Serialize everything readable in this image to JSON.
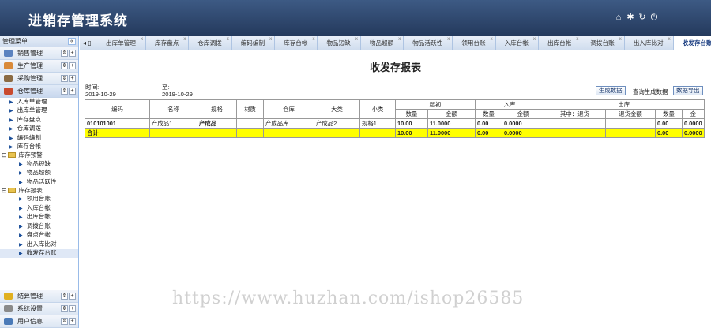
{
  "app": {
    "title": "进销存管理系统"
  },
  "top_icons": [
    {
      "name": "home-icon",
      "glyph": "⌂"
    },
    {
      "name": "gear-icon",
      "glyph": "✱"
    },
    {
      "name": "refresh-icon",
      "glyph": "↻"
    },
    {
      "name": "power-icon",
      "glyph": "⏻"
    }
  ],
  "sidebar": {
    "header": "管理菜单",
    "collapse": "«",
    "groups_top": [
      {
        "label": "销售管理",
        "color": "#5b83c0"
      },
      {
        "label": "生产管理",
        "color": "#d98a3a"
      },
      {
        "label": "采购管理",
        "color": "#8b6b44"
      },
      {
        "label": "仓库管理",
        "color": "#c94a2e"
      }
    ],
    "tree": [
      {
        "label": "入库单管理",
        "type": "node"
      },
      {
        "label": "出库单管理",
        "type": "node"
      },
      {
        "label": "库存盘点",
        "type": "node"
      },
      {
        "label": "仓库调拨",
        "type": "node"
      },
      {
        "label": "编码编制",
        "type": "node"
      },
      {
        "label": "库存台帐",
        "type": "node"
      },
      {
        "label": "库存预警",
        "type": "folder"
      },
      {
        "label": "物品短缺",
        "type": "sub"
      },
      {
        "label": "物品超额",
        "type": "sub"
      },
      {
        "label": "物品活跃性",
        "type": "sub"
      },
      {
        "label": "库存报表",
        "type": "folder"
      },
      {
        "label": "领用台账",
        "type": "sub"
      },
      {
        "label": "入库台帐",
        "type": "sub"
      },
      {
        "label": "出库台帐",
        "type": "sub"
      },
      {
        "label": "调拨台账",
        "type": "sub"
      },
      {
        "label": "盘点台帐",
        "type": "sub"
      },
      {
        "label": "出入库比对",
        "type": "sub"
      },
      {
        "label": "收发存台账",
        "type": "sub"
      }
    ],
    "groups_bottom": [
      {
        "label": "结算管理",
        "color": "#e0b020"
      },
      {
        "label": "系统设置",
        "color": "#8a8a8a"
      },
      {
        "label": "用户信息",
        "color": "#4a7ab8"
      }
    ]
  },
  "tabs": {
    "nav_left": "◂ ▯",
    "items": [
      "出库单管理",
      "库存盘点",
      "仓库调拨",
      "编码编制",
      "库存台帐",
      "物品短缺",
      "物品超额",
      "物品活跃性",
      "领用台账",
      "入库台帐",
      "出库台帐",
      "调拨台账",
      "出入库比对",
      "收发存台账"
    ],
    "active": "收发存台账",
    "close": "x"
  },
  "report": {
    "title": "收发存报表",
    "time_label": "时间:",
    "to_label": "至:",
    "date_from": "2019-10-29",
    "date_to": "2019-10-29",
    "btn_generate": "生成数据",
    "link_query": "查询生成数据",
    "btn_export": "数据导出",
    "headers": {
      "code": "编码",
      "name": "名称",
      "spec": "规格",
      "material": "材质",
      "warehouse": "仓库",
      "major": "大类",
      "minor": "小类",
      "opening": "起初",
      "inbound": "入库",
      "outbound": "出库",
      "qty": "数量",
      "amount": "金额",
      "return_in": "其中：退货",
      "return_amt": "退货金额",
      "amt_cut": "金"
    },
    "row": {
      "code": "010101001",
      "name": "产成品1",
      "spec": "产成品",
      "material": "",
      "warehouse": "产成品库",
      "major": "产成品2",
      "minor": "规格1",
      "open_qty": "10.00",
      "open_amt": "11.0000",
      "in_qty": "0.00",
      "in_amt": "0.0000",
      "ret": "",
      "ret_amt": "",
      "out_qty": "0.00",
      "out_amt": "0.0000"
    },
    "total": {
      "label": "合计",
      "open_qty": "10.00",
      "open_amt": "11.0000",
      "in_qty": "0.00",
      "in_amt": "0.0000",
      "out_qty": "0.00",
      "out_amt": "0.0000"
    }
  },
  "watermark": "https://www.huzhan.com/ishop26585"
}
